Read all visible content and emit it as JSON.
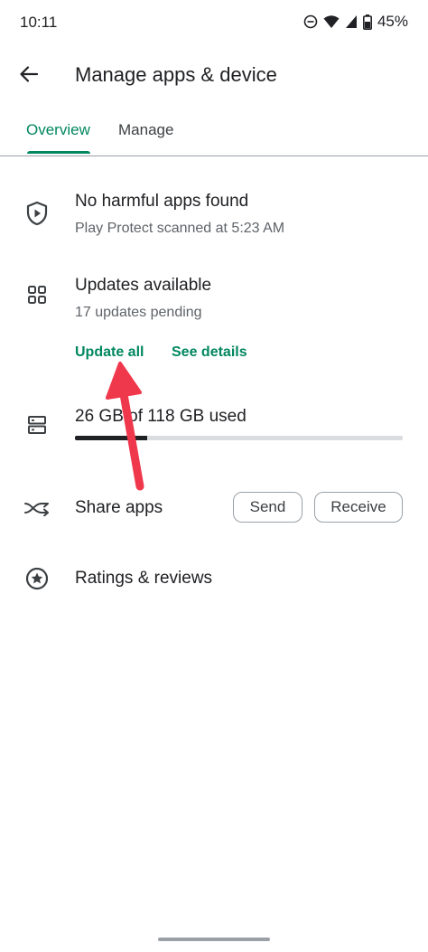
{
  "status_bar": {
    "time": "10:11",
    "battery": "45%",
    "icons": [
      "do-not-disturb-icon",
      "wifi-icon",
      "cell-signal-icon",
      "battery-icon"
    ]
  },
  "app_bar": {
    "back_icon": "arrow-back-icon",
    "title": "Manage apps & device"
  },
  "tabs": [
    {
      "label": "Overview",
      "selected": true
    },
    {
      "label": "Manage",
      "selected": false
    }
  ],
  "protect": {
    "icon": "shield-play-icon",
    "title": "No harmful apps found",
    "subtitle": "Play Protect scanned at 5:23 AM"
  },
  "updates": {
    "icon": "apps-grid-icon",
    "title": "Updates available",
    "subtitle": "17 updates pending",
    "update_all_label": "Update all",
    "see_details_label": "See details"
  },
  "storage": {
    "icon": "storage-icon",
    "label": "26 GB of 118 GB used",
    "used_gb": 26,
    "total_gb": 118
  },
  "share": {
    "icon": "share-apps-icon",
    "title": "Share apps",
    "send_label": "Send",
    "receive_label": "Receive"
  },
  "ratings": {
    "icon": "star-circle-icon",
    "title": "Ratings & reviews"
  },
  "colors": {
    "accent": "#01875f",
    "annotation": "#f0384c",
    "text": "#202124",
    "secondary": "#5f6368"
  }
}
